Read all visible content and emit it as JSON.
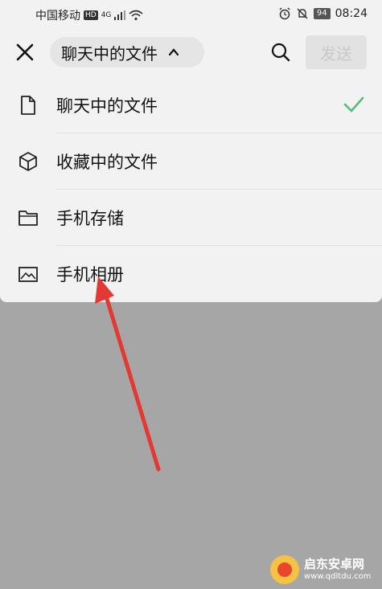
{
  "status_bar": {
    "carrier": "中国移动",
    "hd": "HD",
    "network": "4G",
    "battery": "94",
    "time": "08:24"
  },
  "header": {
    "title": "聊天中的文件",
    "send_label": "发送"
  },
  "menu": {
    "items": [
      {
        "label": "聊天中的文件",
        "icon": "document-icon",
        "selected": true
      },
      {
        "label": "收藏中的文件",
        "icon": "cube-icon",
        "selected": false
      },
      {
        "label": "手机存储",
        "icon": "folder-icon",
        "selected": false
      },
      {
        "label": "手机相册",
        "icon": "image-icon",
        "selected": false
      }
    ]
  },
  "colors": {
    "check": "#4dbf7a",
    "arrow": "#e23a32",
    "overlay": "#a6a6a6"
  },
  "watermark": {
    "name": "启东安卓网",
    "url": "www.qdltdu.com"
  }
}
